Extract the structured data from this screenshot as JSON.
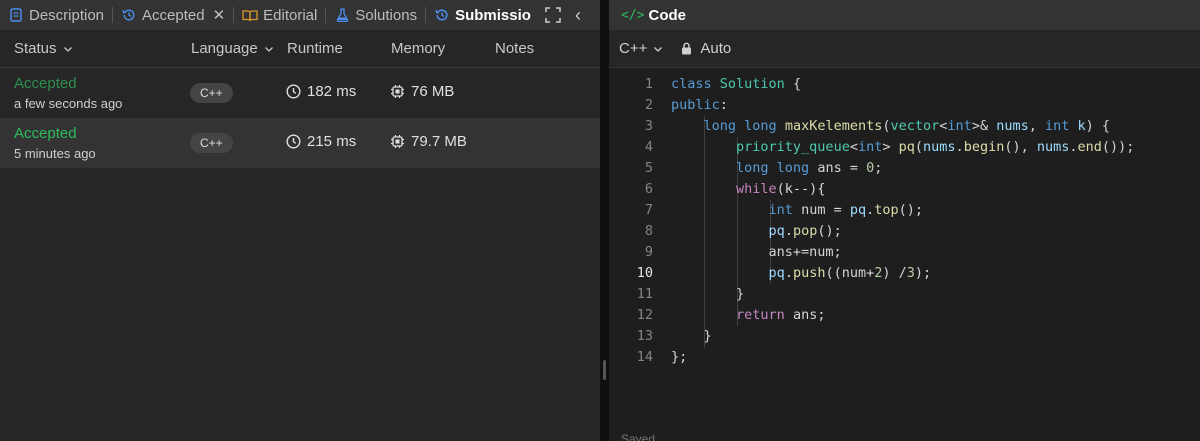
{
  "left_tabs": [
    {
      "label": "Description",
      "icon": "description-icon"
    },
    {
      "label": "Accepted",
      "icon": "history-icon"
    },
    {
      "label": "Editorial",
      "icon": "book-icon"
    },
    {
      "label": "Solutions",
      "icon": "flask-icon"
    },
    {
      "label": "Submissio",
      "icon": "history-icon"
    }
  ],
  "table": {
    "headers": {
      "status": "Status",
      "language": "Language",
      "runtime": "Runtime",
      "memory": "Memory",
      "notes": "Notes"
    },
    "rows": [
      {
        "status": "Accepted",
        "when": "a few seconds ago",
        "language": "C++",
        "runtime": "182 ms",
        "memory": "76 MB"
      },
      {
        "status": "Accepted",
        "when": "5 minutes ago",
        "language": "C++",
        "runtime": "215 ms",
        "memory": "79.7 MB"
      }
    ]
  },
  "code_panel": {
    "title": "Code",
    "code_icon": "</>",
    "language": "C++",
    "mode": "Auto",
    "footer": "Saved",
    "current_line": 10,
    "lines": [
      "class Solution {",
      "public:",
      "    long long maxKelements(vector<int>& nums, int k) {",
      "        priority_queue<int> pq(nums.begin(), nums.end());",
      "        long long ans = 0;",
      "        while(k--){",
      "            int num = pq.top();",
      "            pq.pop();",
      "            ans+=num;",
      "            pq.push((num+2) /3);",
      "        }",
      "        return ans;",
      "    }",
      "};"
    ]
  },
  "colors": {
    "accepted": "#2cbb5d",
    "accent_blue": "#3b82f6",
    "panel": "#262626",
    "editor": "#1e1e1e"
  }
}
